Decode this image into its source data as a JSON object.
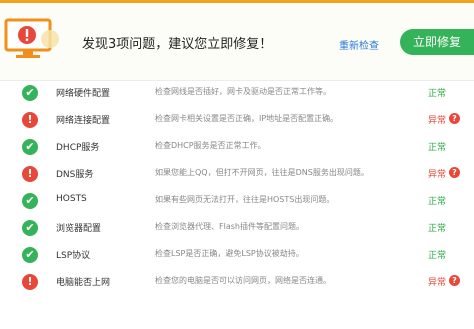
{
  "header": {
    "title": "发现3项问题，建议您立即修复！",
    "recheck_label": "重新检查",
    "repair_label": "立即修复",
    "hero_icon": "monitor-alert-icon"
  },
  "colors": {
    "ok": "#35b35a",
    "error": "#e8483a",
    "link": "#2a7ad6",
    "accent": "#f3a31a"
  },
  "items": [
    {
      "icon": "check-icon",
      "name": "网络硬件配置",
      "desc": "检查网线是否插好，网卡及驱动是否正常工作等。",
      "status": "正常",
      "state": "ok"
    },
    {
      "icon": "exclamation-icon",
      "name": "网络连接配置",
      "desc": "检查网卡相关设置是否正确，IP地址是否配置正确。",
      "status": "异常",
      "state": "error"
    },
    {
      "icon": "check-icon",
      "name": "DHCP服务",
      "desc": "检查DHCP服务是否正常工作。",
      "status": "正常",
      "state": "ok"
    },
    {
      "icon": "exclamation-icon",
      "name": "DNS服务",
      "desc": "如果您能上QQ，但打不开网页，往往是DNS服务出现问题。",
      "status": "异常",
      "state": "error"
    },
    {
      "icon": "check-icon",
      "name": "HOSTS",
      "desc": "如果有些网页无法打开，往往是HOSTS出现问题。",
      "status": "正常",
      "state": "ok"
    },
    {
      "icon": "check-icon",
      "name": "浏览器配置",
      "desc": "检查浏览器代理、Flash插件等配置问题。",
      "status": "正常",
      "state": "ok"
    },
    {
      "icon": "check-icon",
      "name": "LSP协议",
      "desc": "检查LSP是否正确，避免LSP协议被劫持。",
      "status": "正常",
      "state": "ok"
    },
    {
      "icon": "exclamation-icon",
      "name": "电脑能否上网",
      "desc": "检查您的电脑是否可以访问网页，网络是否连通。",
      "status": "异常",
      "state": "error"
    }
  ]
}
